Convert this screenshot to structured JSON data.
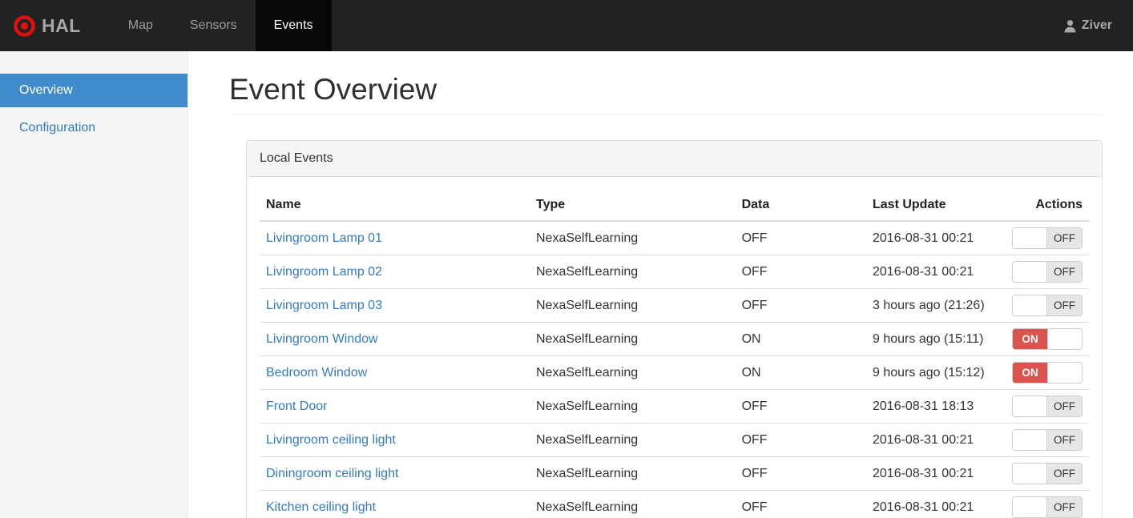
{
  "navbar": {
    "brand": "HAL",
    "items": [
      {
        "label": "Map",
        "active": false
      },
      {
        "label": "Sensors",
        "active": false
      },
      {
        "label": "Events",
        "active": true
      }
    ],
    "user": "Ziver"
  },
  "sidebar": {
    "items": [
      {
        "label": "Overview",
        "active": true
      },
      {
        "label": "Configuration",
        "active": false
      }
    ]
  },
  "main": {
    "title": "Event Overview",
    "panel": {
      "title": "Local Events",
      "table": {
        "columns": [
          "Name",
          "Type",
          "Data",
          "Last Update",
          "Actions"
        ],
        "rows": [
          {
            "name": "Livingroom Lamp 01",
            "type": "NexaSelfLearning",
            "data": "OFF",
            "last_update": "2016-08-31 00:21",
            "switch": "OFF"
          },
          {
            "name": "Livingroom Lamp 02",
            "type": "NexaSelfLearning",
            "data": "OFF",
            "last_update": "2016-08-31 00:21",
            "switch": "OFF"
          },
          {
            "name": "Livingroom Lamp 03",
            "type": "NexaSelfLearning",
            "data": "OFF",
            "last_update": "3 hours ago (21:26)",
            "switch": "OFF"
          },
          {
            "name": "Livingroom Window",
            "type": "NexaSelfLearning",
            "data": "ON",
            "last_update": "9 hours ago (15:11)",
            "switch": "ON"
          },
          {
            "name": "Bedroom Window",
            "type": "NexaSelfLearning",
            "data": "ON",
            "last_update": "9 hours ago (15:12)",
            "switch": "ON"
          },
          {
            "name": "Front Door",
            "type": "NexaSelfLearning",
            "data": "OFF",
            "last_update": "2016-08-31 18:13",
            "switch": "OFF"
          },
          {
            "name": "Livingroom ceiling light",
            "type": "NexaSelfLearning",
            "data": "OFF",
            "last_update": "2016-08-31 00:21",
            "switch": "OFF"
          },
          {
            "name": "Diningroom ceiling light",
            "type": "NexaSelfLearning",
            "data": "OFF",
            "last_update": "2016-08-31 00:21",
            "switch": "OFF"
          },
          {
            "name": "Kitchen ceiling light",
            "type": "NexaSelfLearning",
            "data": "OFF",
            "last_update": "2016-08-31 00:21",
            "switch": "OFF"
          }
        ]
      }
    }
  },
  "icons": {
    "logo": "bullseye-icon",
    "user": "person-icon"
  },
  "colors": {
    "navbar_bg": "#222222",
    "navbar_active_bg": "#080808",
    "logo_red": "#dd1111",
    "sidebar_active_bg": "#428bca",
    "link_blue": "#337ab7",
    "switch_on_red": "#d9534f",
    "switch_off_gray": "#e6e6e6"
  }
}
